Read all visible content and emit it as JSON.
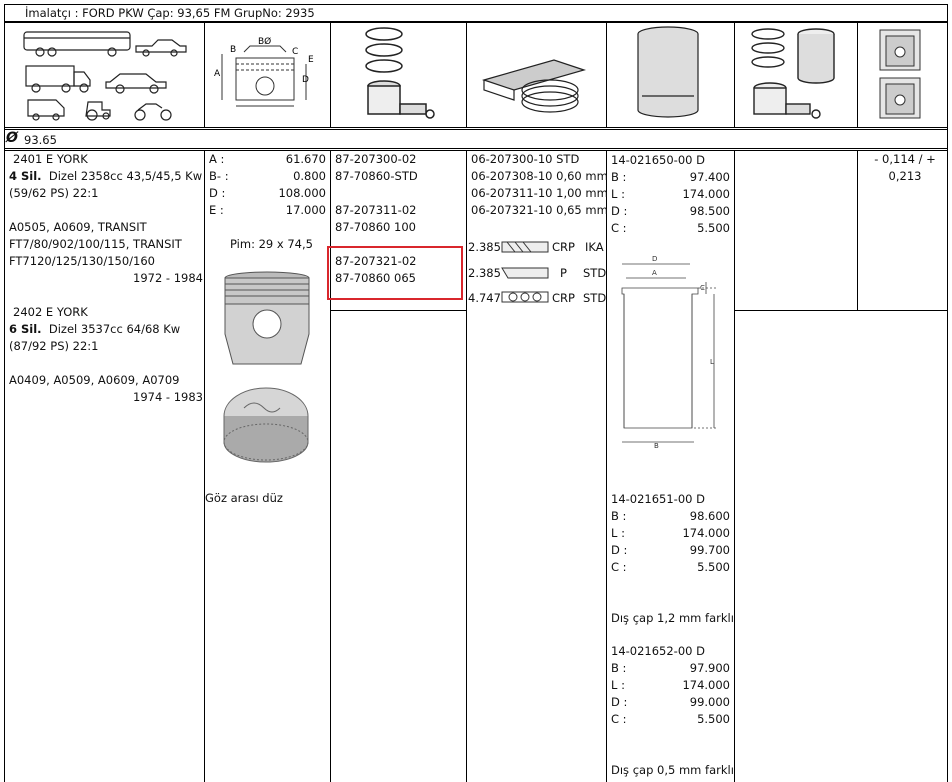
{
  "header": {
    "text": "İmalatçı : FORD PKW   Çap: 93,65   FM GrupNo: 2935"
  },
  "diameter": {
    "symbol": "Ø",
    "value": "93.65"
  },
  "icons": {
    "vehicles": "vehicle-types-icon",
    "dimension_diagram": "piston-dimension-diagram-icon",
    "rings": "piston-rings-icon",
    "ring_box": "ring-set-box-icon",
    "liner": "cylinder-liner-icon",
    "kit": "liner-kit-icon",
    "pin_clearance": "piston-clearance-icon"
  },
  "diagram_labels": {
    "b0": "BØ",
    "b": "B",
    "c": "C",
    "e": "E",
    "a": "A",
    "d": "D"
  },
  "engines": [
    {
      "code": "2401 E YORK",
      "cyl": "4 Sil.",
      "desc": "Dizel 2358cc 43,5/45,5 Kw",
      "ps": "(59/62 PS) 22:1",
      "models1": "A0505, A0609, TRANSIT",
      "models2": "FT7/80/902/100/115, TRANSIT",
      "models3": "FT7120/125/130/150/160",
      "years": "1972 - 1984"
    },
    {
      "code": "2402 E YORK",
      "cyl": "6 Sil.",
      "desc": "Dizel 3537cc 64/68 Kw",
      "ps": "(87/92 PS) 22:1",
      "models1": "A0409, A0509, A0609, A0709",
      "years": "1974 - 1983"
    }
  ],
  "piston_dims": [
    {
      "label": "A :",
      "value": "61.670"
    },
    {
      "label": "B- :",
      "value": "0.800"
    },
    {
      "label": "D :",
      "value": "108.000"
    },
    {
      "label": "E :",
      "value": "17.000"
    }
  ],
  "pin": "Pim: 29 x 74,5",
  "piston_note": "Göz arası düz",
  "piston_codes": [
    "87-207300-02",
    "87-70860-STD",
    "87-207311-02",
    "87-70860 100",
    "87-207321-02",
    "87-70860 065"
  ],
  "ring_codes": [
    "06-207300-10 STD",
    "06-207308-10 0,60 mm",
    "06-207311-10 1,00 mm",
    "06-207321-10 0,65 mm"
  ],
  "ring_types": [
    {
      "width": "2.385",
      "type": "CRP",
      "variant": "IKA"
    },
    {
      "width": "2.385",
      "type": "P",
      "variant": "STD"
    },
    {
      "width": "4.747",
      "type": "CRP",
      "variant": "STD"
    }
  ],
  "liners": [
    {
      "code": "14-021650-00 D",
      "dims": [
        [
          "B :",
          "97.400"
        ],
        [
          "L :",
          "174.000"
        ],
        [
          "D :",
          "98.500"
        ],
        [
          "C :",
          "5.500"
        ]
      ]
    },
    {
      "code": "14-021651-00 D",
      "dims": [
        [
          "B :",
          "98.600"
        ],
        [
          "L :",
          "174.000"
        ],
        [
          "D :",
          "99.700"
        ],
        [
          "C :",
          "5.500"
        ]
      ],
      "note": "Dış çap 1,2 mm farklı"
    },
    {
      "code": "14-021652-00 D",
      "dims": [
        [
          "B :",
          "97.900"
        ],
        [
          "L :",
          "174.000"
        ],
        [
          "D :",
          "99.000"
        ],
        [
          "C :",
          "5.500"
        ]
      ],
      "note": "Dış çap 0,5 mm farklı"
    }
  ],
  "liner_drawing_labels": {
    "d": "D",
    "a": "A",
    "c": "C",
    "l": "L",
    "b": "B"
  },
  "clearance": {
    "line1": "- 0,114 / +",
    "line2": "0,213"
  },
  "highlight_color": "#d9262c"
}
